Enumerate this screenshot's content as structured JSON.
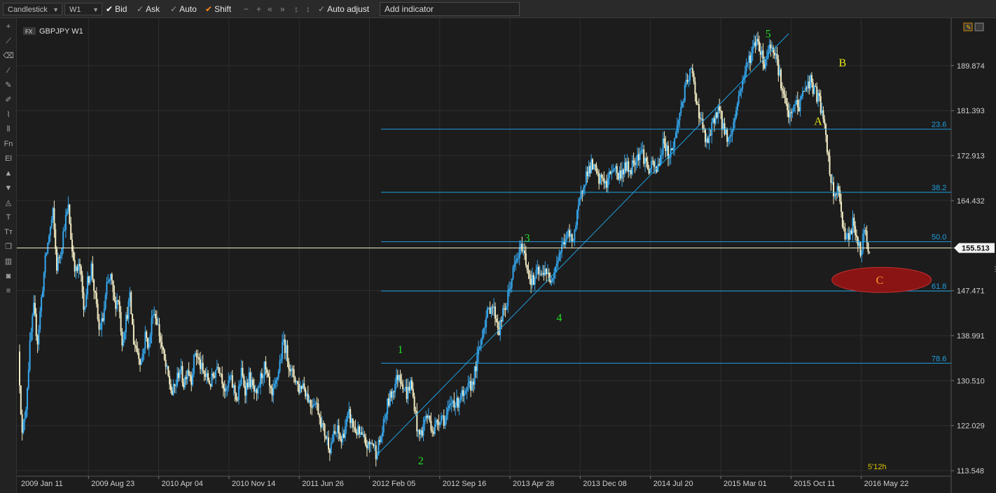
{
  "toolbar": {
    "chart_type": "Candlestick",
    "timeframe": "W1",
    "bid_label": "Bid",
    "ask_label": "Ask",
    "auto_label": "Auto",
    "shift_label": "Shift",
    "auto_adjust_label": "Auto adjust",
    "add_indicator_value": "Add indicator"
  },
  "sidebar": {
    "icons": [
      "add-icon",
      "ruler-icon",
      "eraser-icon",
      "line-tool-icon",
      "pencil-icon",
      "pen-icon",
      "brush-icon",
      "bar-tool-icon",
      "fn-icon",
      "el-icon",
      "arrow-up-icon",
      "arrow-down-icon",
      "shapes-icon",
      "text-icon",
      "text-size-icon",
      "layers-icon",
      "volume-icon",
      "camera-icon",
      "list-icon"
    ],
    "fn_label": "Fn",
    "el_label": "El",
    "t_label": "T",
    "tt_label": "Tт"
  },
  "chart_header": {
    "badge": "FX",
    "symbol": "GBPJPY W1"
  },
  "colors": {
    "background": "#1c1c1c",
    "grid": "#2e2e2e",
    "bull_candle": "#35a7ee",
    "bear_candle": "#f2ecc4",
    "fib_line": "#1f9fe0",
    "price_line": "#f7f2cc",
    "wave_green": "#22dd22",
    "wave_yellow": "#e8e81a",
    "target_ellipse": "#8a1414",
    "target_text": "#ff9a2a"
  },
  "chart_data": {
    "type": "candlestick",
    "symbol": "GBPJPY",
    "timeframe": "W1",
    "ylim": [
      112.5,
      197.5
    ],
    "y_ticks": [
      "189.874",
      "181.393",
      "172.913",
      "164.432",
      "155.513",
      "147.471",
      "138.991",
      "130.510",
      "122.029",
      "113.548"
    ],
    "x_ticks": [
      "2009 Jan 11",
      "2009 Aug 23",
      "2010 Apr 04",
      "2010 Nov 14",
      "2011 Jun 26",
      "2012 Feb 05",
      "2012 Sep 16",
      "2013 Apr 28",
      "2013 Dec 08",
      "2014 Jul 20",
      "2015 Mar 01",
      "2015 Oct 11",
      "2016 May 22"
    ],
    "current_price": "155.513",
    "current_price_value": 155.51,
    "timer": "5'12h",
    "fib_levels": [
      {
        "label": "23.6",
        "price": 177.9
      },
      {
        "label": "38.2",
        "price": 166.0
      },
      {
        "label": "50.0",
        "price": 156.7
      },
      {
        "label": "61.8",
        "price": 147.4
      },
      {
        "label": "78.6",
        "price": 133.8
      }
    ],
    "fib_start_week": 282,
    "impulse_line": {
      "from": {
        "week": 280,
        "price": 116.8
      },
      "to": {
        "week": 600,
        "price": 195.9
      }
    },
    "wave_labels": [
      {
        "label": "1",
        "week": 297,
        "price": 136.5,
        "color": "green"
      },
      {
        "label": "2",
        "week": 313,
        "price": 115.5,
        "color": "green"
      },
      {
        "label": "3",
        "week": 396,
        "price": 157.5,
        "color": "green"
      },
      {
        "label": "4",
        "week": 421,
        "price": 142.5,
        "color": "green"
      },
      {
        "label": "5",
        "week": 584,
        "price": 196.0,
        "color": "green"
      },
      {
        "label": "A",
        "week": 623,
        "price": 179.5,
        "color": "yellow"
      },
      {
        "label": "B",
        "week": 642,
        "price": 190.5,
        "color": "yellow"
      },
      {
        "label": "C",
        "week": 671,
        "price": 149.5,
        "color": "orange"
      }
    ],
    "path_points": [
      [
        0,
        136
      ],
      [
        3,
        120
      ],
      [
        6,
        126
      ],
      [
        9,
        137
      ],
      [
        12,
        144
      ],
      [
        15,
        138
      ],
      [
        18,
        146
      ],
      [
        21,
        153
      ],
      [
        24,
        158
      ],
      [
        27,
        162
      ],
      [
        30,
        152
      ],
      [
        33,
        155
      ],
      [
        36,
        160
      ],
      [
        39,
        163
      ],
      [
        42,
        155
      ],
      [
        45,
        151
      ],
      [
        48,
        152
      ],
      [
        51,
        144
      ],
      [
        54,
        149
      ],
      [
        57,
        152
      ],
      [
        60,
        146
      ],
      [
        63,
        140
      ],
      [
        66,
        142
      ],
      [
        69,
        148
      ],
      [
        72,
        150
      ],
      [
        75,
        145
      ],
      [
        78,
        146
      ],
      [
        81,
        138
      ],
      [
        84,
        142
      ],
      [
        87,
        146
      ],
      [
        90,
        138
      ],
      [
        93,
        136
      ],
      [
        96,
        134
      ],
      [
        99,
        139
      ],
      [
        102,
        137
      ],
      [
        105,
        144
      ],
      [
        108,
        142
      ],
      [
        111,
        138
      ],
      [
        114,
        134
      ],
      [
        117,
        131
      ],
      [
        120,
        128
      ],
      [
        123,
        130
      ],
      [
        126,
        133
      ],
      [
        129,
        130
      ],
      [
        132,
        133
      ],
      [
        135,
        131
      ],
      [
        138,
        136
      ],
      [
        141,
        134
      ],
      [
        144,
        132
      ],
      [
        147,
        131
      ],
      [
        150,
        130
      ],
      [
        153,
        132
      ],
      [
        156,
        134
      ],
      [
        159,
        131
      ],
      [
        162,
        128
      ],
      [
        165,
        131
      ],
      [
        168,
        129
      ],
      [
        171,
        127
      ],
      [
        174,
        132
      ],
      [
        177,
        129
      ],
      [
        180,
        131
      ],
      [
        183,
        129
      ],
      [
        186,
        127
      ],
      [
        189,
        131
      ],
      [
        192,
        133
      ],
      [
        195,
        130
      ],
      [
        198,
        127
      ],
      [
        201,
        130
      ],
      [
        204,
        134
      ],
      [
        207,
        138
      ],
      [
        210,
        135
      ],
      [
        213,
        132
      ],
      [
        216,
        131
      ],
      [
        219,
        129
      ],
      [
        222,
        130
      ],
      [
        225,
        128
      ],
      [
        228,
        126
      ],
      [
        231,
        127
      ],
      [
        234,
        125
      ],
      [
        237,
        122
      ],
      [
        240,
        120
      ],
      [
        243,
        118
      ],
      [
        246,
        120
      ],
      [
        249,
        121
      ],
      [
        252,
        119
      ],
      [
        255,
        122
      ],
      [
        258,
        124
      ],
      [
        261,
        122
      ],
      [
        264,
        121
      ],
      [
        267,
        120
      ],
      [
        270,
        119
      ],
      [
        273,
        118
      ],
      [
        276,
        119
      ],
      [
        279,
        117
      ],
      [
        282,
        119
      ],
      [
        285,
        122
      ],
      [
        288,
        126
      ],
      [
        291,
        128
      ],
      [
        294,
        130
      ],
      [
        297,
        132
      ],
      [
        300,
        130
      ],
      [
        303,
        128
      ],
      [
        306,
        130
      ],
      [
        309,
        126
      ],
      [
        312,
        120
      ],
      [
        315,
        121
      ],
      [
        318,
        124
      ],
      [
        321,
        123
      ],
      [
        324,
        121
      ],
      [
        327,
        123
      ],
      [
        330,
        124
      ],
      [
        333,
        123
      ],
      [
        336,
        125
      ],
      [
        339,
        127
      ],
      [
        342,
        126
      ],
      [
        345,
        128
      ],
      [
        348,
        127
      ],
      [
        351,
        129
      ],
      [
        354,
        130
      ],
      [
        357,
        133
      ],
      [
        360,
        137
      ],
      [
        363,
        141
      ],
      [
        366,
        143
      ],
      [
        369,
        145
      ],
      [
        372,
        143
      ],
      [
        375,
        140
      ],
      [
        378,
        143
      ],
      [
        381,
        145
      ],
      [
        384,
        149
      ],
      [
        387,
        152
      ],
      [
        390,
        154
      ],
      [
        393,
        156
      ],
      [
        396,
        153
      ],
      [
        399,
        150
      ],
      [
        402,
        149
      ],
      [
        405,
        151
      ],
      [
        408,
        150
      ],
      [
        411,
        152
      ],
      [
        414,
        149
      ],
      [
        417,
        151
      ],
      [
        420,
        153
      ],
      [
        423,
        155
      ],
      [
        426,
        157
      ],
      [
        429,
        158
      ],
      [
        432,
        157
      ],
      [
        435,
        160
      ],
      [
        438,
        164
      ],
      [
        441,
        168
      ],
      [
        444,
        170
      ],
      [
        447,
        171
      ],
      [
        450,
        170
      ],
      [
        453,
        168
      ],
      [
        456,
        169
      ],
      [
        459,
        167
      ],
      [
        462,
        170
      ],
      [
        465,
        171
      ],
      [
        468,
        169
      ],
      [
        471,
        170
      ],
      [
        474,
        171
      ],
      [
        477,
        170
      ],
      [
        480,
        172
      ],
      [
        483,
        173
      ],
      [
        486,
        174
      ],
      [
        489,
        172
      ],
      [
        492,
        170
      ],
      [
        495,
        171
      ],
      [
        498,
        170
      ],
      [
        501,
        173
      ],
      [
        504,
        176
      ],
      [
        507,
        173
      ],
      [
        510,
        174
      ],
      [
        513,
        177
      ],
      [
        516,
        181
      ],
      [
        519,
        184
      ],
      [
        522,
        187
      ],
      [
        525,
        189
      ],
      [
        528,
        185
      ],
      [
        531,
        181
      ],
      [
        534,
        178
      ],
      [
        537,
        175
      ],
      [
        540,
        177
      ],
      [
        543,
        180
      ],
      [
        546,
        182
      ],
      [
        549,
        179
      ],
      [
        552,
        177
      ],
      [
        555,
        176
      ],
      [
        558,
        179
      ],
      [
        561,
        183
      ],
      [
        564,
        186
      ],
      [
        567,
        189
      ],
      [
        570,
        191
      ],
      [
        573,
        193
      ],
      [
        576,
        195
      ],
      [
        579,
        193
      ],
      [
        582,
        190
      ],
      [
        585,
        193
      ],
      [
        588,
        194
      ],
      [
        591,
        192
      ],
      [
        594,
        188
      ],
      [
        597,
        184
      ],
      [
        600,
        181
      ],
      [
        603,
        180
      ],
      [
        606,
        183
      ],
      [
        609,
        182
      ],
      [
        612,
        185
      ],
      [
        615,
        186
      ],
      [
        618,
        187
      ],
      [
        621,
        185
      ],
      [
        624,
        184
      ],
      [
        627,
        181
      ],
      [
        630,
        176
      ],
      [
        633,
        170
      ],
      [
        636,
        165
      ],
      [
        639,
        167
      ],
      [
        642,
        162
      ],
      [
        645,
        158
      ],
      [
        648,
        157
      ],
      [
        651,
        160
      ],
      [
        654,
        158
      ],
      [
        657,
        154
      ],
      [
        660,
        159
      ],
      [
        663,
        156
      ]
    ]
  }
}
